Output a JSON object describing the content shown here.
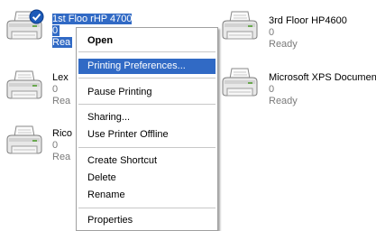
{
  "printers": [
    {
      "name": "1st Floo rHP 4700",
      "docs": "0",
      "status": "Rea",
      "default": true
    },
    {
      "name": "Lex",
      "docs": "0",
      "status": "Rea"
    },
    {
      "name": "Rico",
      "docs": "0",
      "status": "Rea"
    },
    {
      "name": "3rd Floor HP4600",
      "docs": "0",
      "status": "Ready"
    },
    {
      "name": "Microsoft XPS Documen",
      "docs": "0",
      "status": "Ready"
    }
  ],
  "context_menu": {
    "items": [
      {
        "label": "Open"
      },
      {
        "label": "Printing Preferences..."
      },
      {
        "label": "Pause Printing"
      },
      {
        "label": "Sharing..."
      },
      {
        "label": "Use Printer Offline"
      },
      {
        "label": "Create Shortcut"
      },
      {
        "label": "Delete"
      },
      {
        "label": "Rename"
      },
      {
        "label": "Properties"
      }
    ]
  },
  "colors": {
    "selection": "#316ac5",
    "default_badge": "#1d5ab8",
    "status_text": "#7a7a7a"
  },
  "icons": [
    "printer-icon",
    "default-printer-check-icon"
  ]
}
